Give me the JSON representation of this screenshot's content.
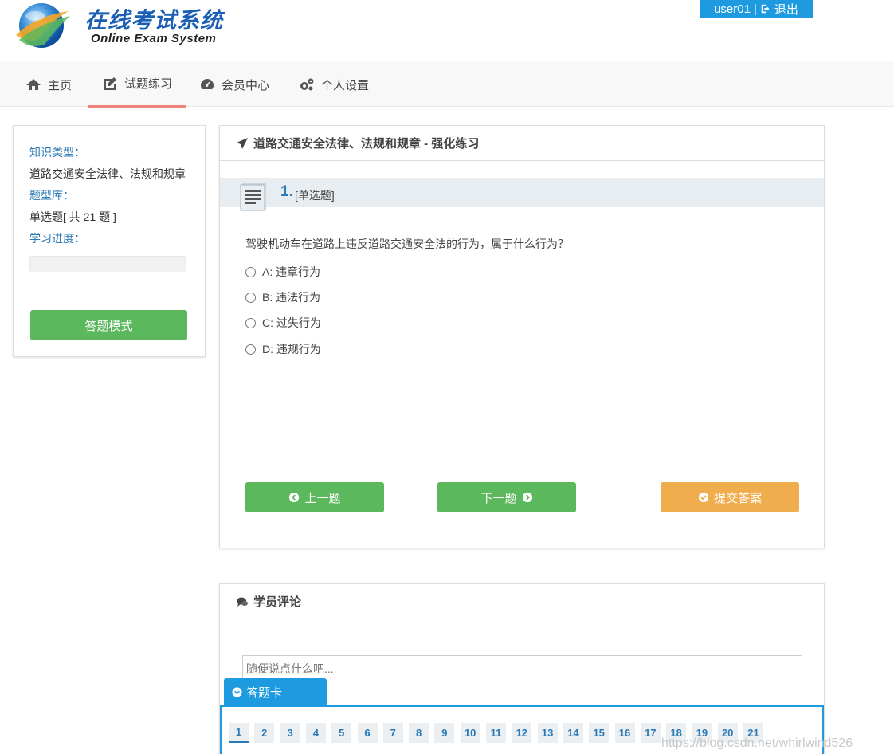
{
  "header": {
    "logo_cn": "在线考试系统",
    "logo_en": "Online Exam System",
    "username": "user01",
    "separator": "|",
    "logout_label": "退出"
  },
  "nav": [
    {
      "label": "主页",
      "icon": "home-icon"
    },
    {
      "label": "试题练习",
      "icon": "edit-icon",
      "active": true
    },
    {
      "label": "会员中心",
      "icon": "dashboard-icon"
    },
    {
      "label": "个人设置",
      "icon": "cogs-icon"
    }
  ],
  "left_panel": {
    "knowledge_label": "知识类型：",
    "knowledge_value": "道路交通安全法律、法规和规章",
    "bank_label": "题型库：",
    "bank_value": "单选题[ 共 21 题 ]",
    "progress_label": "学习进度：",
    "progress_fraction": 0,
    "mode_button": "答题模式"
  },
  "question_panel": {
    "title": "道路交通安全法律、法规和规章 - 强化练习",
    "number": "1.",
    "type": "[单选题]",
    "text": "驾驶机动车在道路上违反道路交通安全法的行为，属于什么行为？",
    "options": [
      "A: 违章行为",
      "B: 违法行为",
      "C: 过失行为",
      "D: 违规行为"
    ],
    "prev_label": "上一题",
    "next_label": "下一题",
    "submit_label": "提交答案"
  },
  "comments": {
    "title": "学员评论",
    "placeholder": "随便说点什么吧..."
  },
  "answer_card": {
    "label": "答题卡",
    "numbers": [
      "1",
      "2",
      "3",
      "4",
      "5",
      "6",
      "7",
      "8",
      "9",
      "10",
      "11",
      "12",
      "13",
      "14",
      "15",
      "16",
      "17",
      "18",
      "19",
      "20",
      "21"
    ],
    "current": "1"
  },
  "watermark": "https://blog.csdn.net/whirlwind526",
  "colors": {
    "brand_blue": "#1e9be0",
    "green": "#5cb85c",
    "orange": "#f0ad4e",
    "label_blue": "#2a7ab8",
    "nav_active": "#f0837a"
  }
}
